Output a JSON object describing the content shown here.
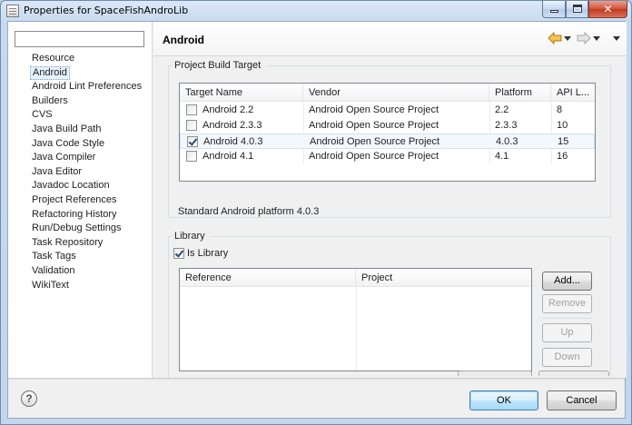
{
  "window": {
    "title": "Properties for SpaceFishAndroLib"
  },
  "sidebar": {
    "filter_value": "",
    "items": [
      {
        "label": "Resource"
      },
      {
        "label": "Android",
        "selected": true
      },
      {
        "label": "Android Lint Preferences"
      },
      {
        "label": "Builders"
      },
      {
        "label": "CVS"
      },
      {
        "label": "Java Build Path"
      },
      {
        "label": "Java Code Style"
      },
      {
        "label": "Java Compiler"
      },
      {
        "label": "Java Editor"
      },
      {
        "label": "Javadoc Location"
      },
      {
        "label": "Project References"
      },
      {
        "label": "Refactoring History"
      },
      {
        "label": "Run/Debug Settings"
      },
      {
        "label": "Task Repository"
      },
      {
        "label": "Task Tags"
      },
      {
        "label": "Validation"
      },
      {
        "label": "WikiText"
      }
    ]
  },
  "page": {
    "title": "Android",
    "build_target": {
      "group_label": "Project Build Target",
      "columns": [
        "Target Name",
        "Vendor",
        "Platform",
        "API L..."
      ],
      "rows": [
        {
          "checked": false,
          "name": "Android 2.2",
          "vendor": "Android Open Source Project",
          "platform": "2.2",
          "api": "8"
        },
        {
          "checked": false,
          "name": "Android 2.3.3",
          "vendor": "Android Open Source Project",
          "platform": "2.3.3",
          "api": "10"
        },
        {
          "checked": true,
          "name": "Android 4.0.3",
          "vendor": "Android Open Source Project",
          "platform": "4.0.3",
          "api": "15"
        },
        {
          "checked": false,
          "name": "Android 4.1",
          "vendor": "Android Open Source Project",
          "platform": "4.1",
          "api": "16"
        }
      ],
      "description": "Standard Android platform 4.0.3"
    },
    "library": {
      "group_label": "Library",
      "is_library_label": "Is Library",
      "is_library_checked": true,
      "columns": [
        "Reference",
        "Project"
      ],
      "buttons": {
        "add": "Add...",
        "remove": "Remove",
        "up": "Up",
        "down": "Down"
      }
    }
  },
  "footer": {
    "ok_label": "OK",
    "cancel_label": "Cancel"
  },
  "colors": {
    "selection_bg": "#e5f1fb",
    "frame": "#c3d6ec",
    "close_button": "#c0391d",
    "nav_arrow": "#e8a21d"
  }
}
